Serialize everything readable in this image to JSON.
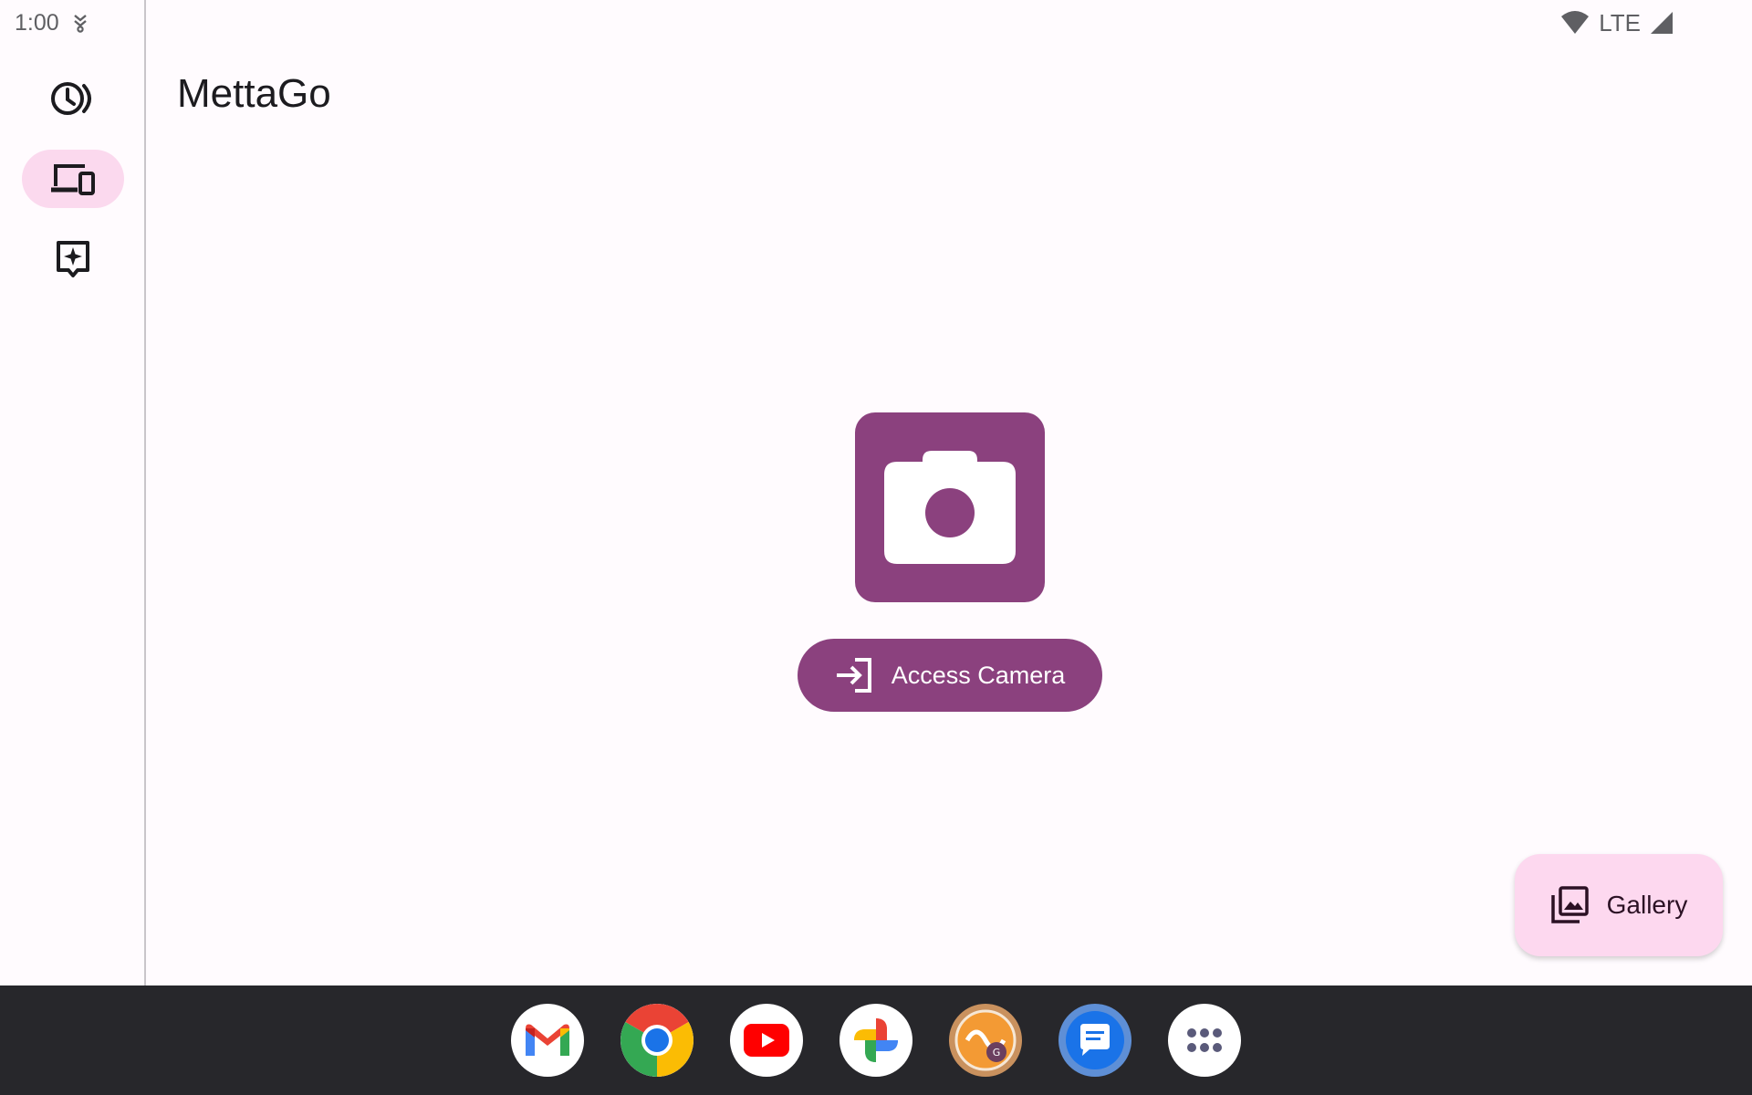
{
  "status_bar": {
    "time": "1:00",
    "network": "LTE"
  },
  "app": {
    "title": "MettaGo"
  },
  "nav_rail": {
    "items": [
      {
        "icon": "history-icon",
        "active": false
      },
      {
        "icon": "devices-icon",
        "active": true
      },
      {
        "icon": "sparkle-feedback-icon",
        "active": false
      }
    ]
  },
  "main": {
    "camera_icon": "camera-icon",
    "access_button_label": "Access Camera",
    "access_button_icon": "login-icon"
  },
  "fab": {
    "label": "Gallery",
    "icon": "photo-library-icon"
  },
  "taskbar": {
    "apps": [
      "gmail-icon",
      "chrome-icon",
      "youtube-icon",
      "photos-icon",
      "mettago-app-icon",
      "messages-icon",
      "app-drawer-icon"
    ]
  },
  "colors": {
    "primary": "#8b417e",
    "active_indicator": "#fbd9ee",
    "fab_background": "#fdd8ef",
    "taskbar": "#27272b",
    "background": "#fffbfe"
  }
}
